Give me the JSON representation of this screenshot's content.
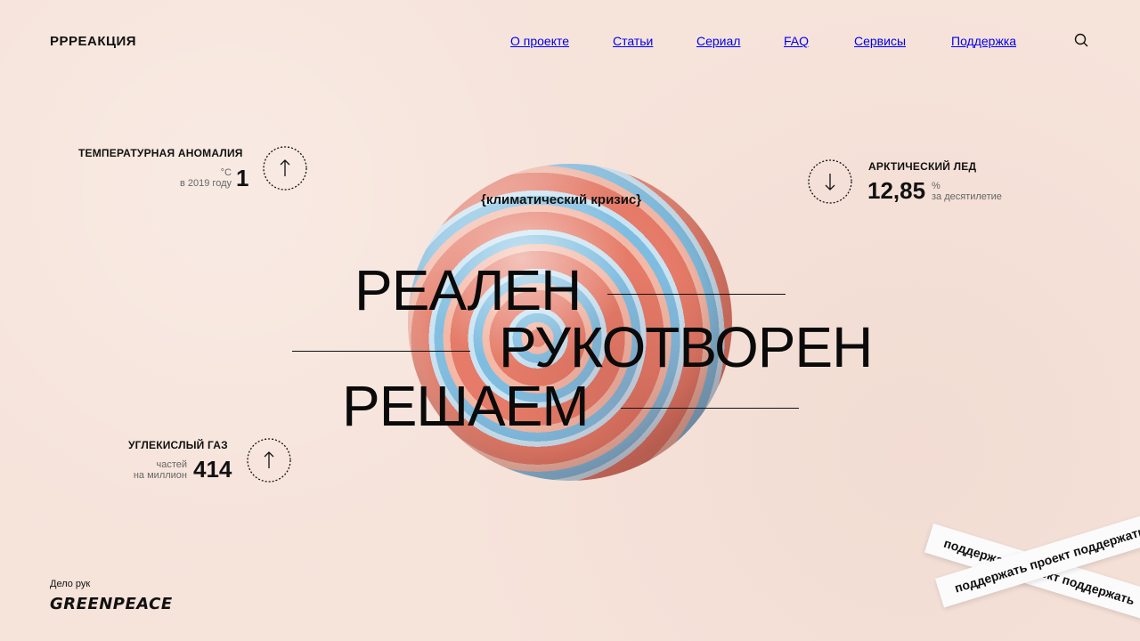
{
  "brand": {
    "logo": "РРРЕАКЦИЯ"
  },
  "nav": {
    "items": [
      "О проекте",
      "Статьи",
      "Сериал",
      "FAQ",
      "Сервисы",
      "Поддержка"
    ],
    "search_icon": "search-icon"
  },
  "stats": {
    "temperature": {
      "title": "ТЕМПЕРАТУРНАЯ АНОМАЛИЯ",
      "unit": "°С",
      "sub": "в 2019 году",
      "value": "1",
      "direction": "up"
    },
    "arctic": {
      "title": "АРКТИЧЕСКИЙ ЛЕД",
      "unit": "%",
      "sub": "за десятилетие",
      "value": "12,85",
      "direction": "down"
    },
    "co2": {
      "title": "УГЛЕКИСЛЫЙ ГАЗ",
      "sub1": "частей",
      "sub2": "на миллион",
      "value": "414",
      "direction": "up"
    }
  },
  "hero": {
    "tag": "{климатический кризис}",
    "line1": "РЕАЛЕН",
    "line2": "РУКОТВОРЕН",
    "line3": "РЕШАЕМ"
  },
  "footer": {
    "label": "Дело рук",
    "partner": "GREENPEACE"
  },
  "ribbons": {
    "top": "поддержать проект поддержать",
    "bottom": "поддержать проект поддержать"
  }
}
